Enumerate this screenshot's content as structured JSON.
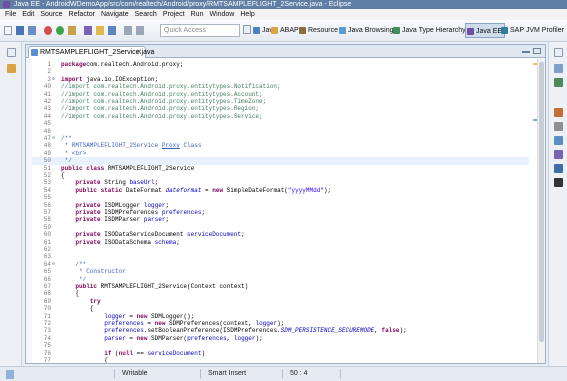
{
  "window": {
    "title": "Java EE - AndroidWDemoApp/src/com/realtech/Android/proxy/RMTSAMPLEFLIGHT_2Service.java - Eclipse"
  },
  "menu": [
    "File",
    "Edit",
    "Source",
    "Refactor",
    "Navigate",
    "Search",
    "Project",
    "Run",
    "Window",
    "Help"
  ],
  "toolbar": {
    "quick_access_placeholder": "Quick Access",
    "perspectives": [
      {
        "label": "Java",
        "icon": "java-perspective-icon",
        "color": "#4f7fc4"
      },
      {
        "label": "ABAP",
        "icon": "abap-perspective-icon",
        "color": "#d9a441"
      },
      {
        "label": "Resource",
        "icon": "resource-perspective-icon",
        "color": "#8a6d3b"
      },
      {
        "label": "Java Browsing",
        "icon": "java-browsing-icon",
        "color": "#5b9bd5"
      },
      {
        "label": "Java Type Hierarchy",
        "icon": "type-hierarchy-icon",
        "color": "#3f8e57"
      },
      {
        "label": "Java EE",
        "icon": "java-ee-perspective-icon",
        "color": "#6f4fa2",
        "active": true
      },
      {
        "label": "SAP JVM Profiler",
        "icon": "profiler-icon",
        "color": "#2e7d9c"
      }
    ]
  },
  "editor": {
    "tab_label": "RMTSAMPLEFLIGHT_2Service.java",
    "lines": [
      {
        "n": "1",
        "fold": "",
        "segs": [
          [
            "kw",
            "package"
          ],
          [
            "",
            "com.realtech.Android.proxy;"
          ]
        ]
      },
      {
        "n": "2",
        "fold": "",
        "segs": []
      },
      {
        "n": "3",
        "fold": "⊕",
        "segs": [
          [
            "kw",
            "import"
          ],
          [
            "",
            " java.io.IOException;"
          ]
        ]
      },
      {
        "n": "40",
        "fold": "",
        "segs": [
          [
            "cm",
            "//import com.realtech.Android.proxy.entitytypes.Notification;"
          ]
        ]
      },
      {
        "n": "41",
        "fold": "",
        "segs": [
          [
            "cm",
            "//import com.realtech.Android.proxy.entitytypes.Account;"
          ]
        ]
      },
      {
        "n": "42",
        "fold": "",
        "segs": [
          [
            "cm",
            "//import com.realtech.Android.proxy.entitytypes.TimeZone;"
          ]
        ]
      },
      {
        "n": "43",
        "fold": "",
        "segs": [
          [
            "cm",
            "//import com.realtech.Android.proxy.entitytypes.Region;"
          ]
        ]
      },
      {
        "n": "44",
        "fold": "",
        "segs": [
          [
            "cm",
            "//import com.realtech.Android.proxy.entitytypes.Service;"
          ]
        ]
      },
      {
        "n": "45",
        "fold": "",
        "segs": []
      },
      {
        "n": "46",
        "fold": "",
        "segs": []
      },
      {
        "n": "47",
        "fold": "⊖",
        "segs": [
          [
            "jd",
            "/**"
          ]
        ]
      },
      {
        "n": "48",
        "fold": "",
        "segs": [
          [
            "jd",
            " * RMTSAMPLEFLIGHT_2Service "
          ],
          [
            "jd ul",
            "Proxy"
          ],
          [
            "jd",
            " Class"
          ]
        ]
      },
      {
        "n": "49",
        "fold": "",
        "segs": [
          [
            "jd",
            " * <br>"
          ]
        ]
      },
      {
        "n": "50",
        "fold": "",
        "segs": [
          [
            "jd",
            " */"
          ]
        ],
        "hl": true
      },
      {
        "n": "51",
        "fold": "",
        "segs": [
          [
            "kw",
            "public class"
          ],
          [
            "",
            " RMTSAMPLEFLIGHT_2Service"
          ]
        ]
      },
      {
        "n": "52",
        "fold": "",
        "segs": [
          [
            "",
            "{"
          ]
        ]
      },
      {
        "n": "53",
        "fold": "",
        "segs": [
          [
            "",
            "    "
          ],
          [
            "kw",
            "private"
          ],
          [
            "",
            " String "
          ],
          [
            "fld",
            "baseUrl"
          ],
          [
            "",
            ";"
          ]
        ]
      },
      {
        "n": "54",
        "fold": "",
        "segs": [
          [
            "",
            "    "
          ],
          [
            "kw",
            "public static"
          ],
          [
            "",
            " DateFormat "
          ],
          [
            "itf",
            "dateformat"
          ],
          [
            "",
            " = "
          ],
          [
            "kw",
            "new"
          ],
          [
            "",
            " SimpleDateFormat("
          ],
          [
            "st",
            "\"yyyyMMdd\""
          ],
          [
            "",
            ");"
          ]
        ]
      },
      {
        "n": "55",
        "fold": "",
        "segs": []
      },
      {
        "n": "56",
        "fold": "",
        "segs": [
          [
            "",
            "    "
          ],
          [
            "kw",
            "private"
          ],
          [
            "",
            " ISDMLogger "
          ],
          [
            "fld",
            "logger"
          ],
          [
            "",
            ";"
          ]
        ]
      },
      {
        "n": "57",
        "fold": "",
        "segs": [
          [
            "",
            "    "
          ],
          [
            "kw",
            "private"
          ],
          [
            "",
            " ISDMPreferences "
          ],
          [
            "fld",
            "preferences"
          ],
          [
            "",
            ";"
          ]
        ]
      },
      {
        "n": "58",
        "fold": "",
        "segs": [
          [
            "",
            "    "
          ],
          [
            "kw",
            "private"
          ],
          [
            "",
            " ISDMParser "
          ],
          [
            "fld",
            "parser"
          ],
          [
            "",
            ";"
          ]
        ]
      },
      {
        "n": "59",
        "fold": "",
        "segs": []
      },
      {
        "n": "60",
        "fold": "",
        "segs": [
          [
            "",
            "    "
          ],
          [
            "kw",
            "private"
          ],
          [
            "",
            " ISODataServiceDocument "
          ],
          [
            "fld",
            "serviceDocument"
          ],
          [
            "",
            ";"
          ]
        ]
      },
      {
        "n": "61",
        "fold": "",
        "segs": [
          [
            "",
            "    "
          ],
          [
            "kw",
            "private"
          ],
          [
            "",
            " ISODataSchema "
          ],
          [
            "fld",
            "schema"
          ],
          [
            "",
            ";"
          ]
        ]
      },
      {
        "n": "62",
        "fold": "",
        "segs": []
      },
      {
        "n": "63",
        "fold": "",
        "segs": []
      },
      {
        "n": "64",
        "fold": "⊖",
        "segs": [
          [
            "jd",
            "    /**"
          ]
        ]
      },
      {
        "n": "65",
        "fold": "",
        "segs": [
          [
            "jd",
            "     * Constructor"
          ]
        ]
      },
      {
        "n": "66",
        "fold": "",
        "segs": [
          [
            "jd",
            "     */"
          ]
        ]
      },
      {
        "n": "67",
        "fold": "",
        "segs": [
          [
            "",
            "    "
          ],
          [
            "kw",
            "public"
          ],
          [
            "",
            " RMTSAMPLEFLIGHT_2Service(Context context)"
          ]
        ]
      },
      {
        "n": "68",
        "fold": "",
        "segs": [
          [
            "",
            "    {"
          ]
        ]
      },
      {
        "n": "69",
        "fold": "",
        "segs": [
          [
            "",
            "        "
          ],
          [
            "kw",
            "try"
          ]
        ]
      },
      {
        "n": "70",
        "fold": "",
        "segs": [
          [
            "",
            "        {"
          ]
        ]
      },
      {
        "n": "71",
        "fold": "",
        "segs": [
          [
            "",
            "            "
          ],
          [
            "fld",
            "logger"
          ],
          [
            "",
            " = "
          ],
          [
            "kw",
            "new"
          ],
          [
            "",
            " SDMLogger();"
          ]
        ]
      },
      {
        "n": "72",
        "fold": "",
        "segs": [
          [
            "",
            "            "
          ],
          [
            "fld",
            "preferences"
          ],
          [
            "",
            " = "
          ],
          [
            "kw",
            "new"
          ],
          [
            "",
            " SDMPreferences(context, "
          ],
          [
            "fld",
            "logger"
          ],
          [
            "",
            ");"
          ]
        ]
      },
      {
        "n": "73",
        "fold": "",
        "segs": [
          [
            "",
            "            "
          ],
          [
            "fld",
            "preferences"
          ],
          [
            "",
            ".setBooleanPreference(ISDMPreferences."
          ],
          [
            "itf",
            "SDM_PERSISTENCE_SECUREMODE"
          ],
          [
            "",
            ", "
          ],
          [
            "kw",
            "false"
          ],
          [
            "",
            ");"
          ]
        ]
      },
      {
        "n": "74",
        "fold": "",
        "segs": [
          [
            "",
            "            "
          ],
          [
            "fld",
            "parser"
          ],
          [
            "",
            " = "
          ],
          [
            "kw",
            "new"
          ],
          [
            "",
            " SDMParser("
          ],
          [
            "fld",
            "preferences"
          ],
          [
            "",
            ", "
          ],
          [
            "fld",
            "logger"
          ],
          [
            "",
            ");"
          ]
        ]
      },
      {
        "n": "75",
        "fold": "",
        "segs": []
      },
      {
        "n": "76",
        "fold": "",
        "segs": [
          [
            "",
            "            "
          ],
          [
            "kw",
            "if"
          ],
          [
            "",
            " ("
          ],
          [
            "kw",
            "null"
          ],
          [
            "",
            " == "
          ],
          [
            "fld",
            "serviceDocument"
          ],
          [
            "",
            ")"
          ]
        ]
      },
      {
        "n": "77",
        "fold": "",
        "segs": [
          [
            "",
            "            {"
          ]
        ]
      }
    ]
  },
  "status": {
    "mode": "Writable",
    "insert": "Smart Insert",
    "position": "50 : 4"
  }
}
